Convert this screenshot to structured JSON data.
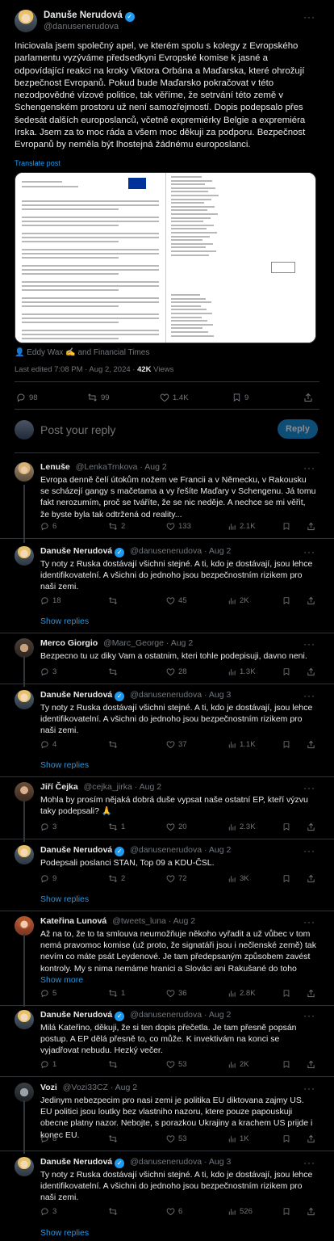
{
  "main": {
    "name": "Danuše Nerudová",
    "handle": "@danusenerudova",
    "text": "Iniciovala jsem společný apel, ve kterém spolu s kolegy z Evropského parlamentu vyzýváme předsedkyni Evropské komise k jasné a odpovídající reakci na kroky Viktora Orbána a Maďarska, které ohrožují bezpečnost Evropanů. Pokud bude Maďarsko pokračovat v této nezodpovědné vízové politice, tak věříme, že setrvání této země v Schengenském prostoru už není samozřejmostí. Dopis podepsalo přes šedesát dalších europoslanců, včetně expremiérky Belgie a expremiéra Irska. Jsem za to moc ráda a všem moc děkuji za podporu. Bezpečnost Evropanů by neměla být lhostejná žádnému europoslanci.",
    "translate": "Translate post",
    "tagged": "Eddy Wax ✍ and Financial Times",
    "edited_prefix": "Last edited 7:08 PM · Aug 2, 2024 · ",
    "views_count": "42K",
    "views_word": " Views",
    "stats": {
      "replies": "98",
      "reposts": "99",
      "likes": "1.4K",
      "bookmarks": "9"
    }
  },
  "reply_box": {
    "placeholder": "Post your reply",
    "button": "Reply"
  },
  "replies": [
    {
      "name": "Lenuše",
      "meta": "@LenkaTrnkova · Aug 2",
      "text": "Evropa denně čelí útokům nožem ve Francii a v Německu, v Rakousku se scházejí gangy s mačetama a vy řešíte  Maďary v Schengenu. Já tomu fakt nerozumím, proč se tváříte, že se nic neděje. A nechce se mi věřit, že byste byla tak odtržená od reality...",
      "stats": [
        "6",
        "2",
        "133",
        "2.1K"
      ],
      "show": ""
    },
    {
      "name": "Danuše Nerudová",
      "meta": "@danusenerudova · Aug 2",
      "text": "Ty noty z Ruska dostávají všichni stejné. A ti, kdo je dostávají, jsou lehce identifikovatelní. A všichni do jednoho jsou bezpečnostním rizikem pro naši zemi.",
      "stats": [
        "18",
        "",
        "45",
        "2K"
      ],
      "show": "Show replies"
    },
    {
      "name": "Merco Giorgio",
      "meta": "@Marc_George · Aug 2",
      "text": "Bezpecno tu uz diky Vam a ostatnim, kteri tohle podepisuji, davno neni.",
      "stats": [
        "3",
        "",
        "28",
        "1.3K"
      ],
      "show": ""
    },
    {
      "name": "Danuše Nerudová",
      "meta": "@danusenerudova · Aug 3",
      "text": "Ty noty z Ruska dostávají všichni stejné. A ti, kdo je dostávají, jsou lehce identifikovatelní. A všichni do jednoho jsou bezpečnostním rizikem pro naši zemi.",
      "stats": [
        "4",
        "",
        "37",
        "1.1K"
      ],
      "show": "Show replies"
    },
    {
      "name": "Jiří Čejka",
      "meta": "@cejka_jirka · Aug 2",
      "text": "Mohla by prosím nějaká dobrá duše vypsat naše ostatní EP,  kteří výzvu taky podepsali? 🙏",
      "stats": [
        "3",
        "1",
        "20",
        "2.3K"
      ],
      "show": ""
    },
    {
      "name": "Danuše Nerudová",
      "meta": "@danusenerudova · Aug 2",
      "text": "Podepsali poslanci STAN, Top 09 a KDU-ČSL.",
      "stats": [
        "9",
        "2",
        "72",
        "3K"
      ],
      "show": "Show replies"
    },
    {
      "name": "Kateřina Lunová",
      "meta": "@tweets_luna · Aug 2",
      "text": "Až na to, že to ta smlouva neumožňuje někoho vyřadit a už vůbec v tom nemá pravomoc komise (už proto, že signatáři jsou i nečlenské země) tak nevím co máte psát Leydenové. Je tam předepsaným způsobem zavést kontroly. My s nima nemáme hranici a Slováci ani Rakušané do toho",
      "more": "Show more",
      "stats": [
        "5",
        "1",
        "36",
        "2.8K"
      ],
      "show": ""
    },
    {
      "name": "Danuše Nerudová",
      "meta": "@danusenerudova · Aug 2",
      "text": "Milá Kateřino, děkuji, že si ten dopis přečetla. Je tam přesně popsán postup. A EP dělá přesně to, co může. K invektivám na konci se vyjadřovat nebudu. Hezký večer.",
      "stats": [
        "1",
        "",
        "53",
        "2K"
      ],
      "show": ""
    },
    {
      "name": "Vozi",
      "meta": "@Vozi33CZ · Aug 2",
      "text": "Jedinym nebezpecim pro nasi zemi je politika EU diktovana zajmy US. EU politici jsou loutky bez vlastniho nazoru, ktere pouze papouskuji obecne platny nazor. Nebojte, s porazkou Ukrajiny a krachem US prijde i konec EU.",
      "stats": [
        "8",
        "",
        "53",
        "1K"
      ],
      "show": ""
    },
    {
      "name": "Danuše Nerudová",
      "meta": "@danusenerudova · Aug 3",
      "text": "Ty noty z Ruska dostávají všichni stejné. A ti, kdo je dostávají, jsou lehce identifikovatelní. A všichni do jednoho jsou bezpečnostním rizikem pro naši zemi.",
      "stats": [
        "3",
        "",
        "6",
        "526"
      ],
      "show": "Show replies"
    }
  ]
}
